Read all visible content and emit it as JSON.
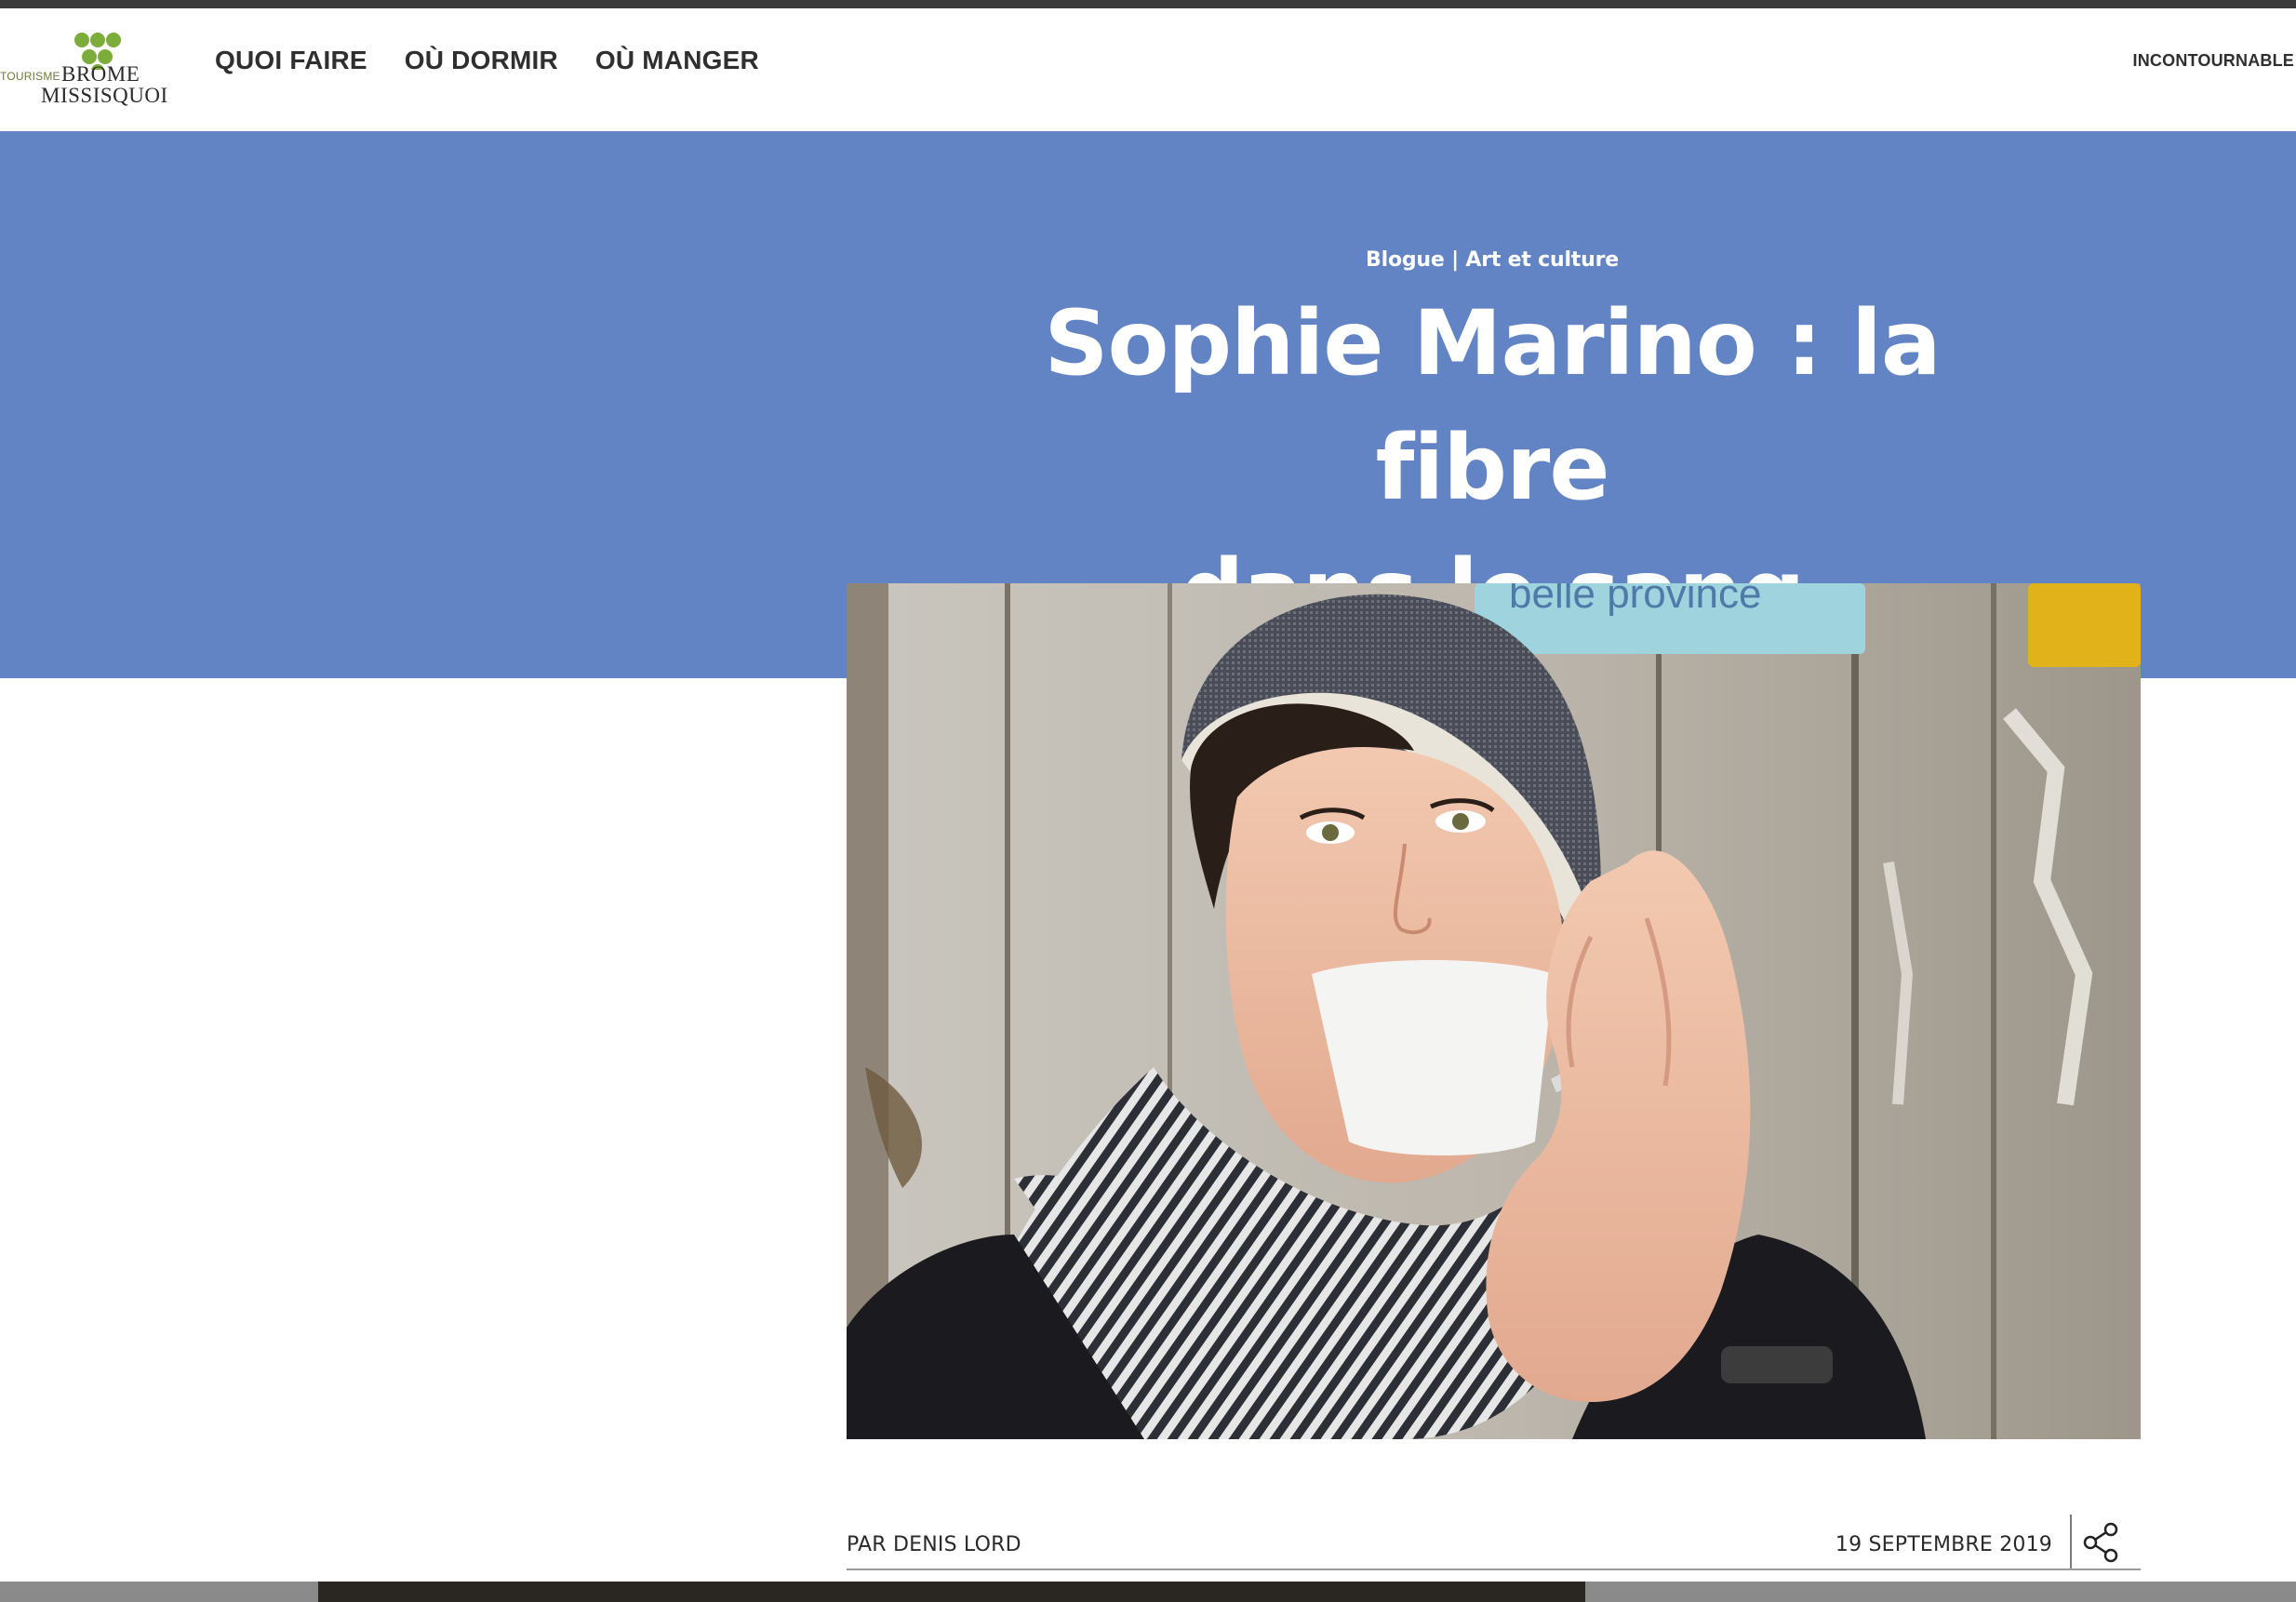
{
  "header": {
    "logo": {
      "tourisme": "TOURISME",
      "brome": "BROME",
      "missisquoi": "MISSISQUOI"
    },
    "nav": [
      {
        "label": "QUOI FAIRE"
      },
      {
        "label": "OÙ DORMIR"
      },
      {
        "label": "OÙ MANGER"
      }
    ],
    "nav_right": "INCONTOURNABLE"
  },
  "hero": {
    "breadcrumb": {
      "section": "Blogue",
      "separator": "|",
      "category": "Art et culture"
    },
    "title_line1": "Sophie Marino : la fibre",
    "title_line2": "dans le sang"
  },
  "photo": {
    "sign_text": "belle province"
  },
  "byline": {
    "author": "PAR DENIS LORD",
    "date": "19 SEPTEMBRE 2019",
    "share_icon": "share-icon"
  },
  "colors": {
    "hero_blue": "#6284c4",
    "logo_green": "#7cad3a",
    "text_dark": "#2f2f2f"
  }
}
